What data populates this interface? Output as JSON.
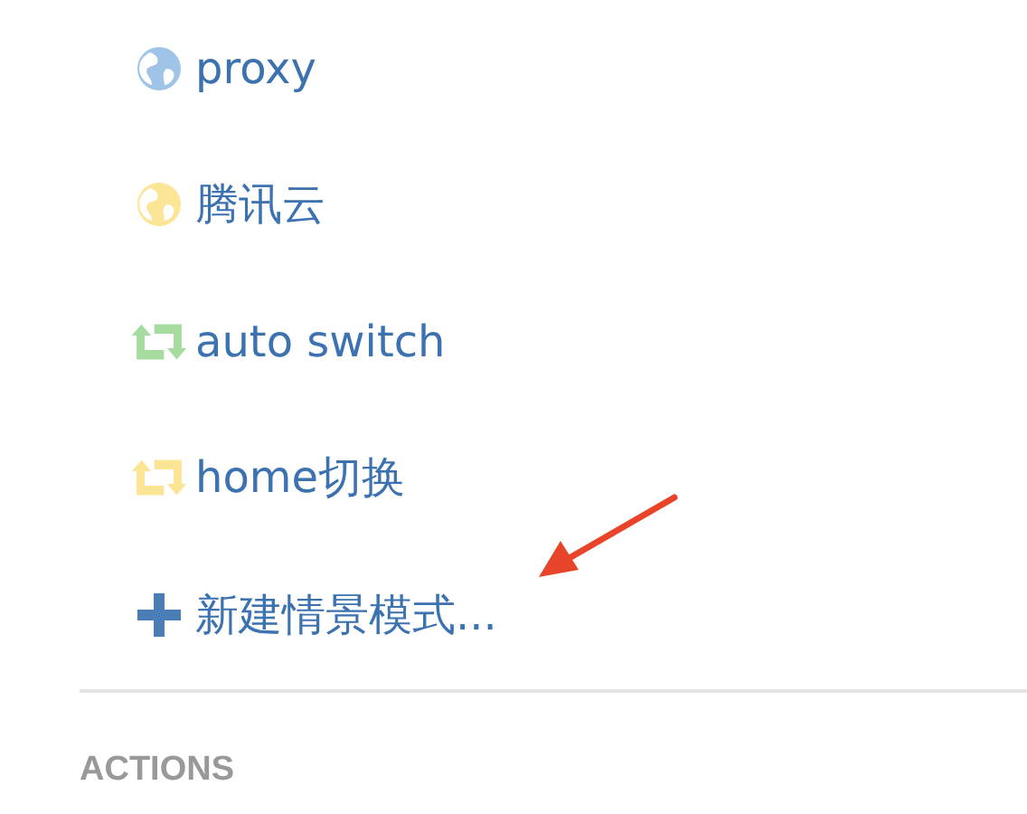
{
  "profiles": [
    {
      "kind": "globe",
      "label": "proxy",
      "color": "#a0c4e8"
    },
    {
      "kind": "globe",
      "label": "腾讯云",
      "color": "#fce596"
    },
    {
      "kind": "switch",
      "label": "auto switch",
      "color": "#a6dca0"
    },
    {
      "kind": "switch",
      "label": "home切换",
      "color": "#fce596"
    },
    {
      "kind": "add",
      "label": "新建情景模式...",
      "color": "#4a7cb5"
    }
  ],
  "section": {
    "title": "ACTIONS"
  }
}
